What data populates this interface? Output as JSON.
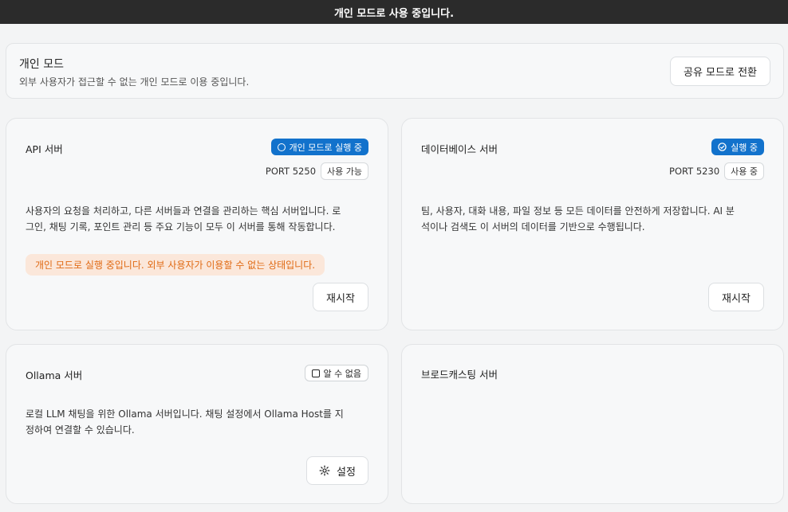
{
  "banner": {
    "text": "개인 모드로 사용 중입니다."
  },
  "mode": {
    "title": "개인 모드",
    "description": "외부 사용자가 접근할 수 없는 개인 모드로 이용 중입니다.",
    "switch_label": "공유 모드로 전환"
  },
  "servers": {
    "api": {
      "title": "API 서버",
      "status": "개인 모드로 실행 중",
      "port": "PORT 5250",
      "availability": "사용 가능",
      "description_1": "사용자의 요청을 처리하고, 다른 서버들과 연결을 관리하는 핵심 서버입니다. 로",
      "description_2": "그인, 채팅 기록, 포인트 관리 등 주요 기능이 모두 이 서버를 통해 작동합니다.",
      "warning": "개인 모드로 실행 중입니다. 외부 사용자가 이용할 수 없는 상태입니다.",
      "restart_label": "재시작"
    },
    "database": {
      "title": "데이터베이스 서버",
      "status": "실행 중",
      "port": "PORT 5230",
      "availability": "사용 중",
      "description_1": "팀, 사용자, 대화 내용, 파일 정보 등 모든 데이터를 안전하게 저장합니다. AI 분",
      "description_2": "석이나 검색도 이 서버의 데이터를 기반으로 수행됩니다.",
      "restart_label": "재시작"
    },
    "ollama": {
      "title": "Ollama 서버",
      "status": "알 수 없음",
      "description_1": "로컬 LLM 채팅을 위한 Ollama 서버입니다. 채팅 설정에서 Ollama Host를 지",
      "description_2": "정하여 연결할 수 있습니다.",
      "settings_label": "설정"
    },
    "broadcast": {
      "title": "브로드캐스팅 서버"
    }
  },
  "colors": {
    "accent_blue": "#1272cc",
    "warning_bg": "#fbe7da",
    "warning_text": "#e06a14",
    "banner_bg": "#2b2b2b"
  },
  "icons": {
    "api_status": "circle-icon",
    "db_status": "check-circle-icon",
    "ollama_status": "square-icon",
    "settings": "gear-icon"
  }
}
